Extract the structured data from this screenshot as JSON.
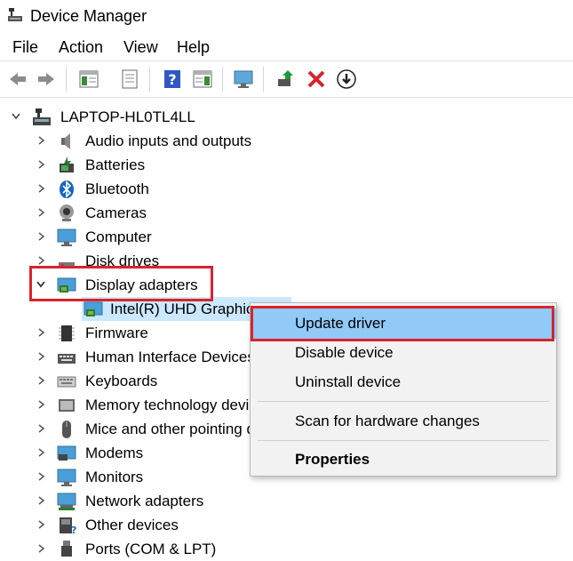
{
  "window": {
    "title": "Device Manager"
  },
  "menu": [
    "File",
    "Action",
    "View",
    "Help"
  ],
  "toolbar": [
    "back-arrow-icon",
    "forward-arrow-icon",
    "show-hide-console-tree-icon",
    "properties-sheet-icon",
    "help-icon",
    "action-pane-icon",
    "scan-monitor-icon",
    "update-driver-icon",
    "uninstall-red-x-icon",
    "download-circle-icon"
  ],
  "tree": {
    "root": "LAPTOP-HL0TL4LL",
    "items": [
      {
        "label": "Audio inputs and outputs",
        "icon": "speaker-icon"
      },
      {
        "label": "Batteries",
        "icon": "battery-icon"
      },
      {
        "label": "Bluetooth",
        "icon": "bluetooth-icon"
      },
      {
        "label": "Cameras",
        "icon": "camera-icon"
      },
      {
        "label": "Computer",
        "icon": "computer-icon"
      },
      {
        "label": "Disk drives",
        "icon": "disk-drive-icon"
      },
      {
        "label": "Display adapters",
        "icon": "display-adapter-icon",
        "expanded": true
      },
      {
        "label": "Intel(R) UHD Graphics 620",
        "icon": "display-adapter-icon",
        "child": true,
        "selected": true
      },
      {
        "label": "Firmware",
        "icon": "chip-icon"
      },
      {
        "label": "Human Interface Devices",
        "icon": "keyboard-icon"
      },
      {
        "label": "Keyboards",
        "icon": "keyboard-icon"
      },
      {
        "label": "Memory technology devices",
        "icon": "memory-icon"
      },
      {
        "label": "Mice and other pointing devices",
        "icon": "mouse-icon"
      },
      {
        "label": "Modems",
        "icon": "modem-icon"
      },
      {
        "label": "Monitors",
        "icon": "monitor-icon"
      },
      {
        "label": "Network adapters",
        "icon": "network-icon"
      },
      {
        "label": "Other devices",
        "icon": "unknown-device-icon"
      },
      {
        "label": "Ports (COM & LPT)",
        "icon": "port-icon"
      }
    ]
  },
  "context_menu": {
    "items": [
      "Update driver",
      "Disable device",
      "Uninstall device",
      "Scan for hardware changes",
      "Properties"
    ],
    "highlighted": "Update driver"
  },
  "colors": {
    "highlight_red": "#d9232e",
    "selection_blue": "#cce8ff",
    "menu_hover": "#91c9f7"
  }
}
